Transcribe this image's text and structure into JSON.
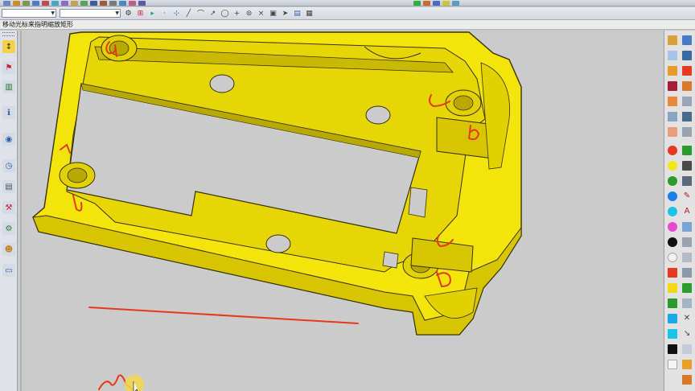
{
  "status": {
    "prompt": "移动光标来指明缩放矩形"
  },
  "toolbar2": {
    "layer_select": "",
    "view_select": ""
  },
  "right_toolbar": {
    "color_swatches": [
      "#e8381f",
      "#f2e615",
      "#2a9b2d",
      "#19a9e8",
      "#e84ad0",
      "#101010",
      "#f4f4f4"
    ],
    "cube_colors": [
      "#e8381f",
      "#f2d915",
      "#2a9b2d",
      "#19a9e8",
      "#101010",
      "#f4f4f4"
    ]
  },
  "canvas": {
    "part_color": "#f3e40b",
    "annotation_color": "#e53a1a",
    "annotations": [
      "a",
      "b",
      "b",
      "b",
      "b",
      "b",
      "b",
      "b",
      "b"
    ]
  }
}
